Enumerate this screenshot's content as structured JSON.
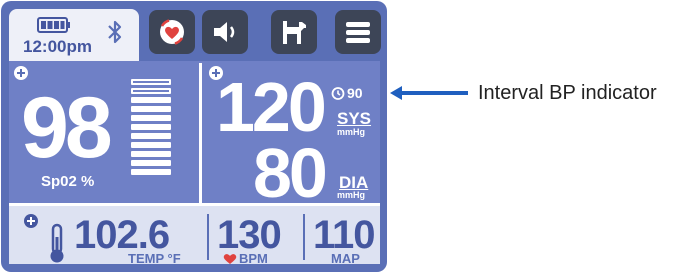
{
  "status": {
    "time": "12:00pm",
    "battery_icon": "battery-full-icon",
    "bluetooth_icon": "bluetooth-icon"
  },
  "toolbar": {
    "buttons": [
      {
        "name": "bp-cycle-button",
        "icon": "heart-cycle-icon"
      },
      {
        "name": "volume-button",
        "icon": "speaker-icon"
      },
      {
        "name": "patient-button",
        "icon": "dog-icon"
      },
      {
        "name": "menu-button",
        "icon": "hamburger-menu-icon"
      }
    ]
  },
  "spo2": {
    "value": "98",
    "label": "Sp02 %",
    "signal_bars_filled": 9,
    "signal_bars_total": 11
  },
  "bp": {
    "systolic": "120",
    "systolic_label": "SYS",
    "systolic_unit": "mmHg",
    "diastolic": "80",
    "diastolic_label": "DIA",
    "diastolic_unit": "mmHg",
    "interval": "90"
  },
  "temp": {
    "value": "102.6",
    "label": "TEMP °F"
  },
  "pulse": {
    "value": "130",
    "label": "BPM"
  },
  "map": {
    "value": "110",
    "label": "MAP"
  },
  "annotation": {
    "text": "Interval BP indicator"
  },
  "colors": {
    "screen_bg": "#5a6fb6",
    "panel_bg": "#6f80c6",
    "light_bg": "#dde2f2",
    "dark_button": "#3d4557",
    "heart": "#e0433f",
    "arrow": "#1f5fbf"
  }
}
